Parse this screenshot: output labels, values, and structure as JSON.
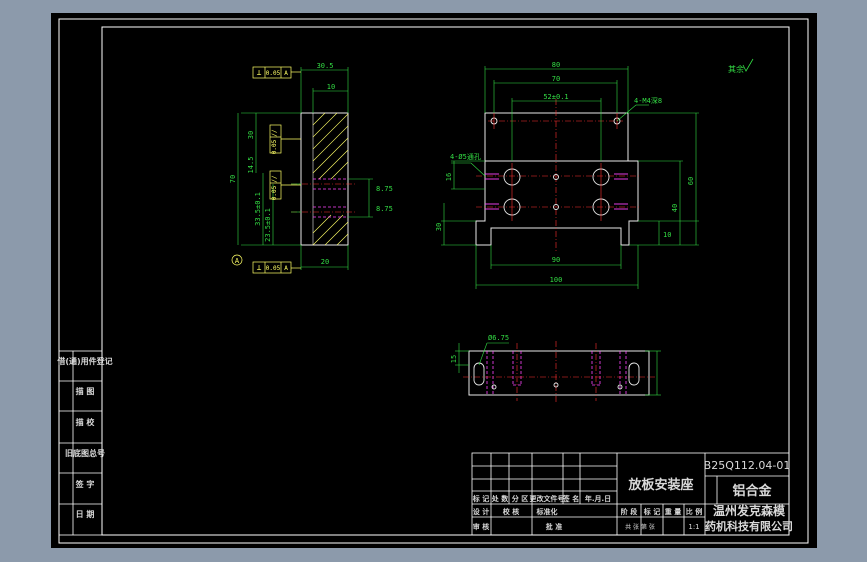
{
  "colors": {
    "background": "#000000",
    "frame": "#ffffff",
    "outline": "#e8e8e8",
    "dimension": "#33dd44",
    "center_line": "#ff3030",
    "hidden_line": "#ff44ff",
    "tolerance": "#ffff66",
    "chrome": "#8c9aab"
  },
  "title_block": {
    "part_name": "放板安装座",
    "drawing_number": "B25Q112.04-01",
    "material": "铝合金",
    "company_line1": "温州发克森模",
    "company_line2": "药机科技有限公司",
    "history_header": [
      "标 记",
      "处 数",
      "分 区",
      "更改文件号",
      "签 名",
      "年.月.日"
    ],
    "sign_row1": [
      "设 计",
      "",
      "校 核",
      "标准化"
    ],
    "sign_row2": [
      "审 核",
      "",
      "",
      "批 准"
    ],
    "stage_labels": [
      "阶 段",
      "标 记",
      "重 量",
      "比 例"
    ],
    "scale": "1:1",
    "sheet_info": "共 张 第 张"
  },
  "side_table": {
    "cells": [
      "借(通)用件登记",
      "描 图",
      "描 校",
      "旧底图总号",
      "签 字",
      "日 期"
    ]
  },
  "annotations": {
    "roughness": "其余",
    "tolerance_perp": [
      "⊥",
      "0.05",
      "A"
    ],
    "tolerance_par_1": [
      "//",
      "0.05"
    ],
    "tolerance_par_2": [
      "//",
      "0.05"
    ],
    "tolerance_bottom": [
      "⊥",
      "0.05",
      "A"
    ],
    "datum": "A",
    "thread_note": "4-M4深8",
    "hole_note_left": "4-Ø5通孔",
    "hole_note_bottom": "Ø6.75"
  },
  "dimensions": {
    "side_view": {
      "top_width": "30.5",
      "top_inner": "10",
      "overall_height": "70",
      "vert_a": "30",
      "vert_b": "14.5",
      "vert_c": "33.5±0.1",
      "vert_d": "23.5±0.1",
      "right_a": "8.75",
      "right_b": "8.75",
      "bottom_width": "20"
    },
    "front_view": {
      "overall_top": "80",
      "inner_a": "70",
      "inner_b": "52±0.1",
      "height_right_a": "60",
      "height_right_b": "40",
      "height_right_c": "10",
      "left_a": "16",
      "left_b": "30",
      "bottom_inner": "90",
      "bottom_overall": "100"
    },
    "top_view": {
      "left_height": "15"
    }
  }
}
